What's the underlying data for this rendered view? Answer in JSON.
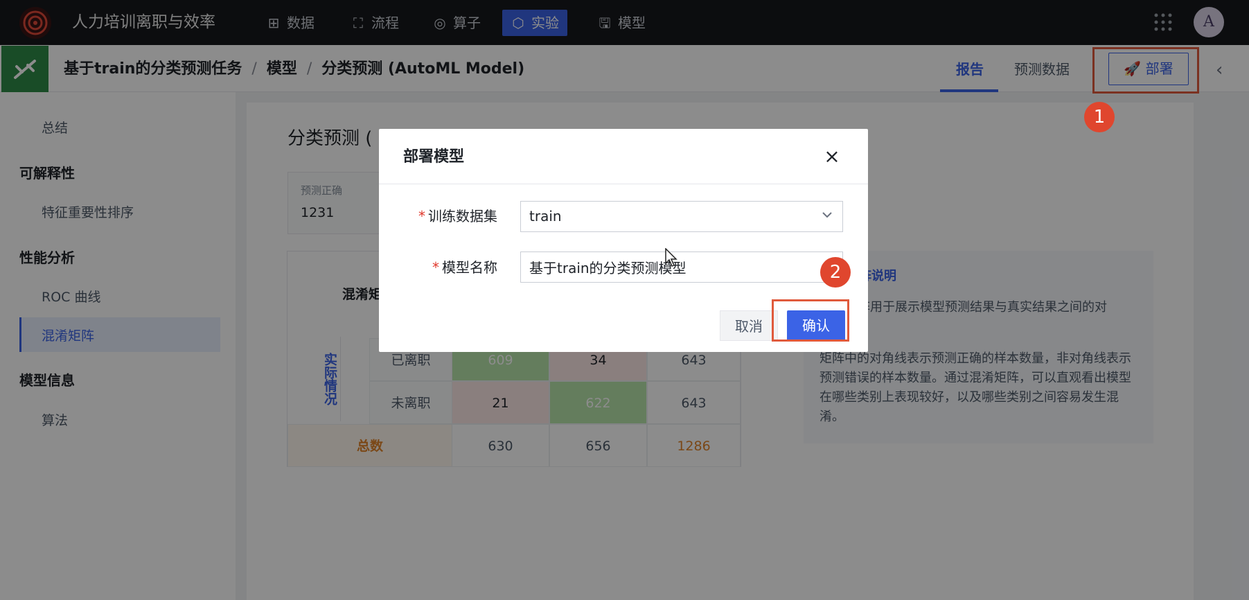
{
  "app": {
    "title": "人力培训离职与效率",
    "nav": [
      {
        "label": "数据",
        "icon": "table-icon"
      },
      {
        "label": "流程",
        "icon": "flow-icon"
      },
      {
        "label": "算子",
        "icon": "operator-icon"
      },
      {
        "label": "实验",
        "icon": "cube-icon",
        "active": true
      },
      {
        "label": "模型",
        "icon": "save-icon"
      }
    ],
    "avatar": "A"
  },
  "breadcrumb": {
    "task": "基于train的分类预测任务",
    "sep": "/",
    "section": "模型",
    "current": "分类预测 (AutoML Model)"
  },
  "tabs": {
    "report": "报告",
    "predict_data": "预测数据",
    "deploy": "部署"
  },
  "sidebar": {
    "summary": "总结",
    "explain_group": "可解释性",
    "feature_importance": "特征重要性排序",
    "perf_group": "性能分析",
    "roc": "ROC 曲线",
    "confusion": "混淆矩阵",
    "model_info_group": "模型信息",
    "algorithm": "算法"
  },
  "main": {
    "title_partial": "分类预测 (",
    "metric_label": "预测正确",
    "metric_value": "1231",
    "cm_title_partial": "混淆矩",
    "actual_label": "实际情况",
    "rows": [
      {
        "label": "已离职",
        "values": [
          "609",
          "34",
          "643"
        ]
      },
      {
        "label": "未离职",
        "values": [
          "21",
          "622",
          "643"
        ]
      }
    ],
    "total_label": "总数",
    "totals": [
      "630",
      "656",
      "1286"
    ],
    "explain_title_partial": "阵说明",
    "explain_p1": "阵用于展示模型预测结果与真实结果之间的对",
    "explain_p2": "矩阵中的对角线表示预测正确的样本数量，非对角线表示预测错误的样本数量。通过混淆矩阵，可以直观看出模型在哪些类别上表现较好，以及哪些类别之间容易发生混淆。"
  },
  "modal": {
    "title": "部署模型",
    "close": "×",
    "required_mark": "*",
    "dataset_label": "训练数据集",
    "dataset_value": "train",
    "name_label": "模型名称",
    "name_value": "基于train的分类预测模型",
    "cancel": "取消",
    "confirm": "确认"
  },
  "steps": {
    "one": "1",
    "two": "2"
  },
  "colors": {
    "accent": "#3b63e6",
    "highlight": "#e05a3c",
    "topbar": "#16181c",
    "task_icon": "#2e8b47"
  }
}
